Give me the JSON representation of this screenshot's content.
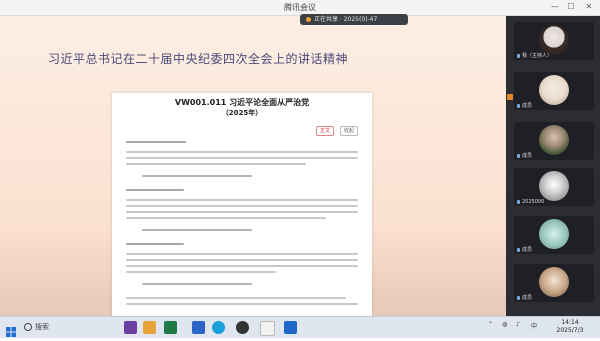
{
  "window": {
    "title": "腾讯会议",
    "minimize_glyph": "—",
    "maximize_glyph": "☐",
    "close_glyph": "✕"
  },
  "share_bar": {
    "text": "正在共享 · 2025(0)-47"
  },
  "slide": {
    "title": "习近平总书记在二十届中央纪委四次全会上的讲话精神",
    "doc": {
      "title": "VW001.011 习近平论全面从严治党",
      "subtitle": "（2025年）",
      "button_primary": "正文",
      "button_secondary": "收起"
    }
  },
  "participants": [
    {
      "name": "我（主持人）",
      "avatar_color": "#d9d2cf"
    },
    {
      "name": "成员",
      "avatar_color": "#e9dccf"
    },
    {
      "name": "成员",
      "avatar_color": "#4a5a3a"
    },
    {
      "name": "2025000",
      "avatar_color": "#9a9a9a"
    },
    {
      "name": "成员",
      "avatar_color": "#9dc9c0"
    },
    {
      "name": "成员",
      "avatar_color": "#c9a98a"
    }
  ],
  "taskbar": {
    "search_text": "搜索",
    "time": "14:14",
    "date": "2025/7/3",
    "input_indicator": "中",
    "colors": {
      "app1": "#6b3fa0",
      "app2": "#e8a33a",
      "app3": "#1e7b45",
      "app4": "#2b63c7",
      "app5": "#1aa0d8",
      "app6": "#333333",
      "app7": "#1f66c9"
    }
  }
}
